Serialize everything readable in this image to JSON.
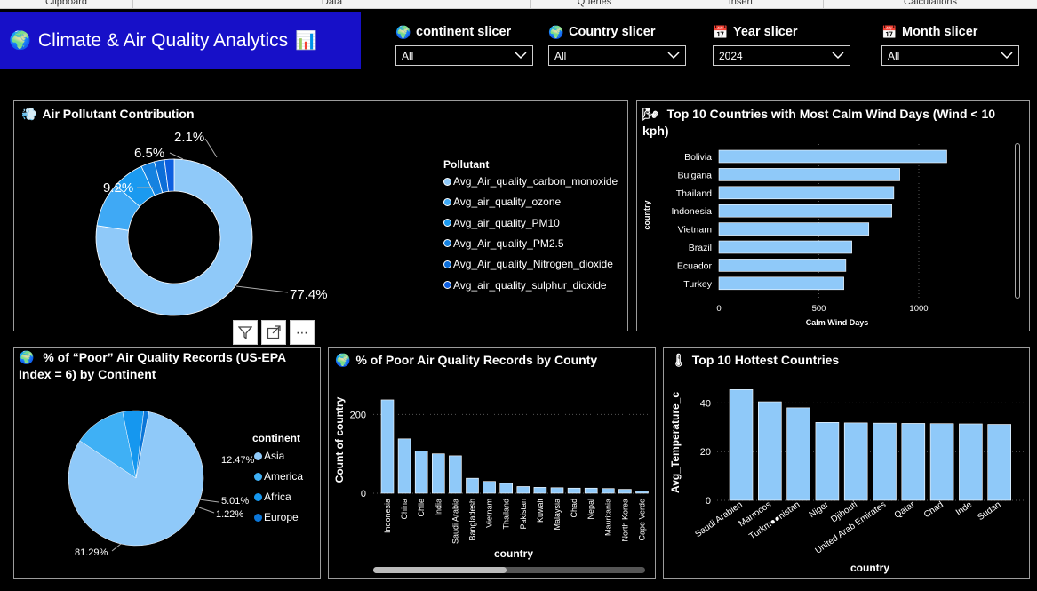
{
  "ribbon": {
    "labels": [
      "Clipboard",
      "Data",
      "Queries",
      "Insert",
      "Calculations"
    ]
  },
  "title": {
    "text": "Climate & Air Quality Analytics",
    "icon_left": "globe-icon",
    "icon_right": "bar-chart-icon"
  },
  "slicers": [
    {
      "label": "continent slicer",
      "value": "All",
      "icon": "globe-icon"
    },
    {
      "label": "Country slicer",
      "value": "All",
      "icon": "globe-icon"
    },
    {
      "label": "Year slicer",
      "value": "2024",
      "icon": "calendar-icon"
    },
    {
      "label": "Month slicer",
      "value": "All",
      "icon": "calendar-icon"
    }
  ],
  "pollutant": {
    "title": "Air Pollutant Contribution",
    "legend_title": "Pollutant",
    "items": [
      "Avg_Air_quality_carbon_monoxide",
      "Avg_air_quality_ozone",
      "Avg_air_quality_PM10",
      "Avg_Air_quality_PM2.5",
      "Avg_Air_quality_Nitrogen_dioxide",
      "Avg_air_quality_sulphur_dioxide"
    ],
    "labels": [
      "77.4%",
      "9.2%",
      "6.5%",
      "2.1%"
    ],
    "colors": [
      "#8fc9f9",
      "#3fa9f5",
      "#1b9af0",
      "#1582e0",
      "#0c6ed8",
      "#0d5fe0"
    ]
  },
  "calm": {
    "title": "Top 10 Countries with Most Calm Wind Days (Wind < 10 kph)",
    "ylabel": "country",
    "xlabel": "Calm Wind Days",
    "ticks": [
      "0",
      "500",
      "1000"
    ]
  },
  "poor_continent": {
    "title": "% of “Poor” Air Quality Records (US-EPA Index = 6) by Continent",
    "legend_title": "continent",
    "legend": [
      "Asia",
      "America",
      "Africa",
      "Europe"
    ],
    "labels": [
      "81.29%",
      "12.47%",
      "5.01%",
      "1.22%"
    ],
    "colors": [
      "#8fc9f9",
      "#3fb0f5",
      "#1597ef",
      "#0b76d8"
    ]
  },
  "poor_county": {
    "title": "% of Poor Air Quality Records by County",
    "ylabel": "Count of country",
    "xlabel": "country",
    "ticks": [
      "0",
      "200"
    ]
  },
  "hottest": {
    "title": "Top 10 Hottest Countries",
    "ylabel": "Avg_Temperature_c",
    "xlabel": "country",
    "ticks": [
      "0",
      "20",
      "40"
    ]
  },
  "chart_data": [
    {
      "type": "pie",
      "title": "Air Pollutant Contribution",
      "categories": [
        "Avg_Air_quality_carbon_monoxide",
        "Avg_air_quality_ozone",
        "Avg_air_quality_PM10",
        "Avg_Air_quality_PM2.5",
        "Avg_Air_quality_Nitrogen_dioxide",
        "Avg_air_quality_sulphur_dioxide"
      ],
      "values": [
        77.4,
        9.2,
        6.5,
        2.8,
        2.1,
        2.0
      ],
      "style": "donut"
    },
    {
      "type": "bar",
      "orientation": "horizontal",
      "title": "Top 10 Countries with Most Calm Wind Days (Wind < 10 kph)",
      "categories": [
        "Bolivia",
        "Bulgaria",
        "Thailand",
        "Indonesia",
        "Vietnam",
        "Brazil",
        "Ecuador",
        "Turkey"
      ],
      "values": [
        1140,
        905,
        875,
        865,
        750,
        665,
        635,
        625
      ],
      "xlabel": "Calm Wind Days",
      "ylabel": "country",
      "xlim": [
        0,
        1200
      ]
    },
    {
      "type": "pie",
      "title": "% of “Poor” Air Quality Records (US-EPA Index = 6) by Continent",
      "categories": [
        "Asia",
        "America",
        "Africa",
        "Europe"
      ],
      "values": [
        81.29,
        12.47,
        5.01,
        1.22
      ]
    },
    {
      "type": "bar",
      "title": "% of Poor Air Quality Records by County",
      "categories": [
        "Indonesia",
        "China",
        "Chile",
        "India",
        "Saudi Arabia",
        "Bangladesh",
        "Vietnam",
        "Thailand",
        "Pakistan",
        "Kuwait",
        "Malaysia",
        "Chad",
        "Nepal",
        "Mauritania",
        "North Korea",
        "Cape Verde"
      ],
      "values": [
        237,
        138,
        107,
        100,
        95,
        38,
        30,
        25,
        17,
        15,
        14,
        13,
        13,
        12,
        10,
        5
      ],
      "xlabel": "country",
      "ylabel": "Count of country",
      "ylim": [
        0,
        300
      ]
    },
    {
      "type": "bar",
      "title": "Top 10 Hottest Countries",
      "categories": [
        "Saudi Arabien",
        "Marrocos",
        "Turkm●●nistan",
        "Niger",
        "Djibouti",
        "United Arab Emirates",
        "Qatar",
        "Chad",
        "Inde",
        "Sudan"
      ],
      "values": [
        45.5,
        40.5,
        38,
        32,
        31.8,
        31.7,
        31.6,
        31.5,
        31.4,
        31.2
      ],
      "xlabel": "country",
      "ylabel": "Avg_Temperature_c",
      "ylim": [
        0,
        50
      ]
    }
  ]
}
